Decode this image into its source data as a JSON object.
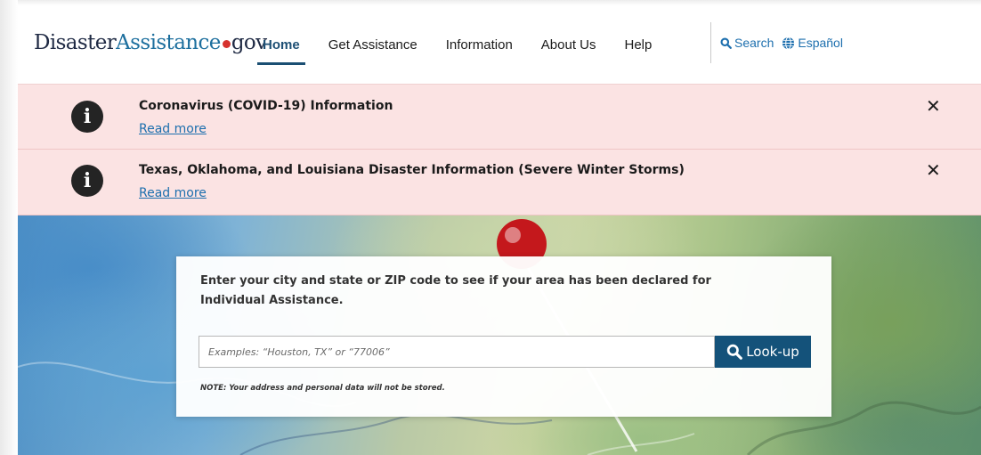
{
  "header": {
    "logo": {
      "part1": "Disaster",
      "part2": "Assistance",
      "part3": "gov"
    },
    "nav": [
      {
        "label": "Home",
        "active": true
      },
      {
        "label": "Get Assistance",
        "active": false
      },
      {
        "label": "Information",
        "active": false
      },
      {
        "label": "About Us",
        "active": false
      },
      {
        "label": "Help",
        "active": false
      }
    ],
    "tools": {
      "search_label": "Search",
      "search_icon": "search-icon",
      "language_label": "Español",
      "language_icon": "globe-icon"
    }
  },
  "alerts": [
    {
      "icon": "info-icon",
      "title": "Coronavirus (COVID-19) Information",
      "link": "Read more",
      "close": "✕"
    },
    {
      "icon": "info-icon",
      "title": "Texas, Oklahoma, and Louisiana Disaster Information (Severe Winter Storms)",
      "link": "Read more",
      "close": "✕"
    }
  ],
  "hero": {
    "prompt": "Enter your city and state or ZIP code to see if your area has been declared for Individual Assistance.",
    "input_placeholder": "Examples: “Houston, TX” or “77006”",
    "input_value": "",
    "button_label": "Look-up",
    "button_icon": "search-icon",
    "note": "NOTE: Your address and personal data will not be stored."
  },
  "colors": {
    "accent": "#14527a",
    "link": "#1d6fae",
    "alert_bg": "#fbe3e3",
    "logo_dot": "#d6322e"
  }
}
